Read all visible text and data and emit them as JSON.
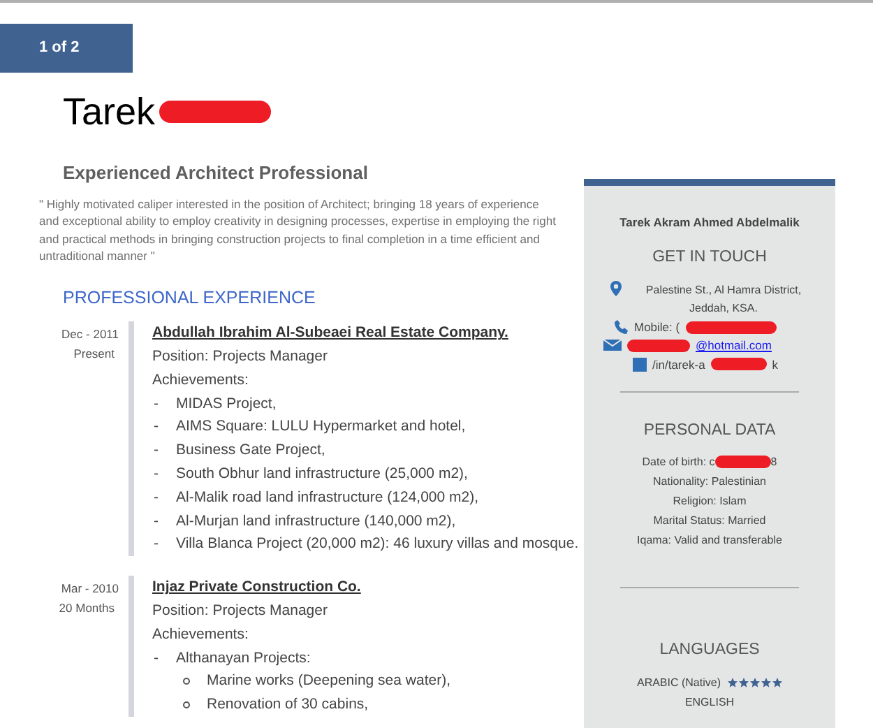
{
  "page_indicator": "1 of 2",
  "name": {
    "first": "Tarek",
    "redacted": true
  },
  "headline": "Experienced Architect Professional",
  "summary": "\" Highly motivated caliper interested in the position of Architect; bringing 18 years of experience and exceptional ability to employ creativity in designing processes, expertise in employing the right and practical methods in bringing construction projects to final completion in a time efficient and untraditional manner \"",
  "experience": {
    "title": "PROFESSIONAL EXPERIENCE",
    "jobs": [
      {
        "date": "Dec - 2011",
        "duration": "Present",
        "company": "Abdullah Ibrahim Al-Subeaei Real Estate Company.",
        "position": "Position: Projects Manager",
        "achievements_label": "Achievements:",
        "items": [
          {
            "marker": "-",
            "text": "MIDAS Project,"
          },
          {
            "marker": "-",
            "text": "AIMS Square: LULU Hypermarket and hotel,"
          },
          {
            "marker": "-",
            "text": "Business Gate Project,"
          },
          {
            "marker": "-",
            "text": "South Obhur land infrastructure (25,000 m2),"
          },
          {
            "marker": "-",
            "text": "Al-Malik road land infrastructure (124,000 m2),"
          },
          {
            "marker": "-",
            "text": "Al-Murjan land infrastructure (140,000 m2),"
          },
          {
            "marker": "-",
            "text": "Villa Blanca Project (20,000 m2): 46 luxury villas and mosque."
          }
        ]
      },
      {
        "date": "Mar - 2010",
        "duration": "20 Months",
        "company": "Injaz Private Construction Co.",
        "position": "Position: Projects Manager",
        "achievements_label": "Achievements:",
        "items": [
          {
            "marker": "-",
            "text": "Althanayan Projects:",
            "children": [
              {
                "text": "Marine works (Deepening sea water),"
              },
              {
                "text": "Renovation of 30 cabins,"
              }
            ]
          }
        ]
      }
    ]
  },
  "sidebar": {
    "full_name": "Tarek Akram Ahmed Abdelmalik",
    "contact": {
      "title": "GET IN TOUCH",
      "address": "Palestine St., Al Hamra District, Jeddah, KSA.",
      "mobile": "Mobile: (",
      "email": "@hotmail.com",
      "linkedin_start": "/in/tarek-a",
      "linkedin_end": "k"
    },
    "personal": {
      "title": "PERSONAL DATA",
      "lines": [
        {
          "text": "Date of birth: c",
          "redacted": true,
          "tail": "8"
        },
        {
          "text": "Nationality: Palestinian",
          "redacted": false
        },
        {
          "text": "Religion: Islam",
          "redacted": false
        },
        {
          "text": "Marital Status: Married",
          "redacted": false
        },
        {
          "text": "Iqama: Valid and transferable",
          "redacted": false
        }
      ]
    },
    "languages": {
      "title": "LANGUAGES",
      "items": [
        {
          "label": "ARABIC (Native)",
          "stars": 5
        },
        {
          "label": "ENGLISH"
        }
      ]
    }
  }
}
